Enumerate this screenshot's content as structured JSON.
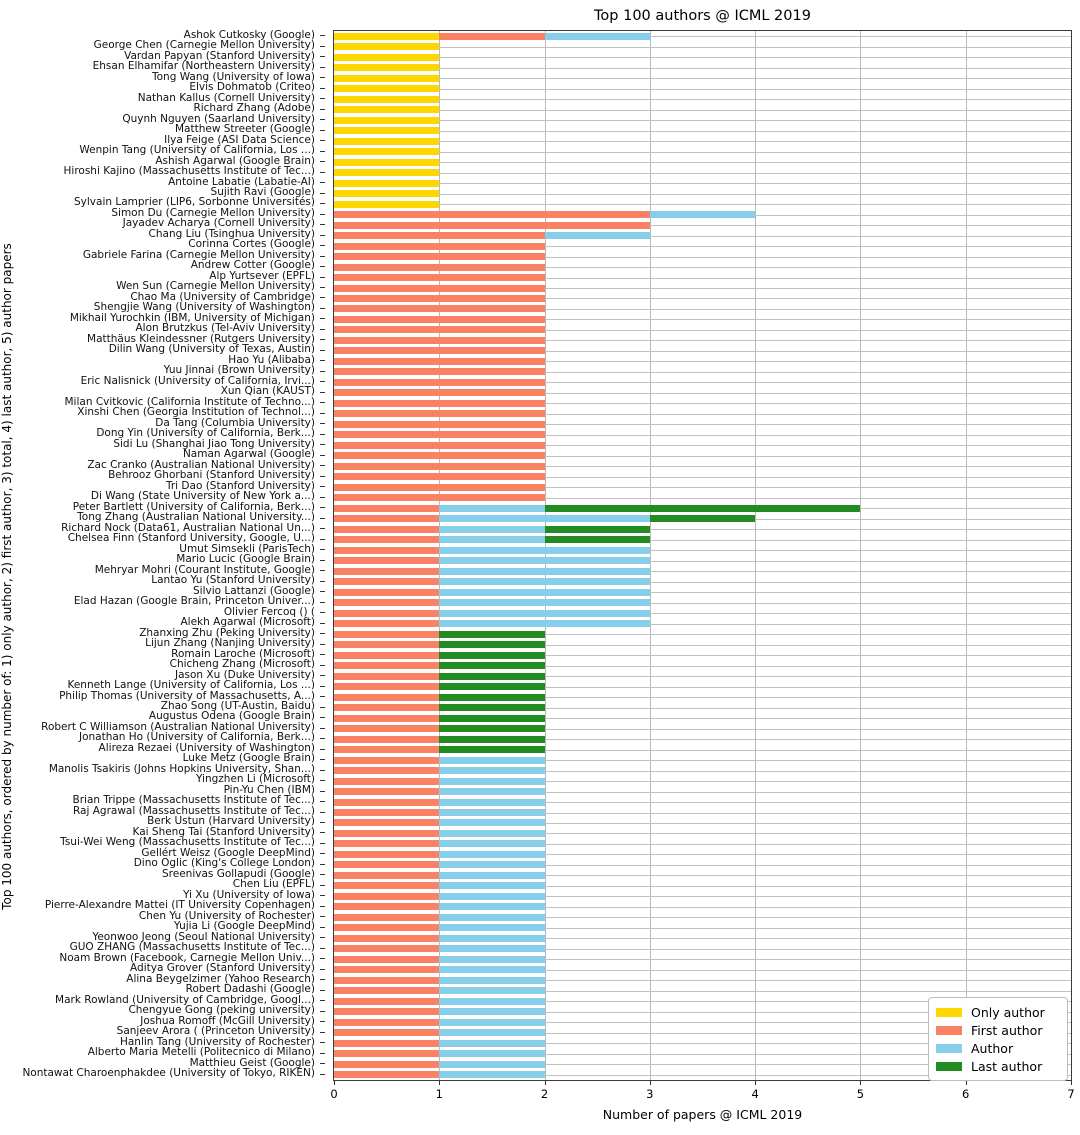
{
  "chart_data": {
    "type": "bar",
    "orientation": "horizontal",
    "stacked": true,
    "title": "Top 100 authors @ ICML 2019",
    "xlabel": "Number of papers @ ICML 2019",
    "ylabel": "Top 100 authors, ordered by number of: 1) only author, 2) first author, 3) total, 4) last author, 5) author papers",
    "xlim": [
      0,
      7
    ],
    "xticks": [
      0,
      1,
      2,
      3,
      4,
      5,
      6,
      7
    ],
    "xtick_labels": [
      "0",
      "1",
      "2",
      "3",
      "4",
      "5",
      "6",
      "7"
    ],
    "grid": true,
    "legend_position": "lower right",
    "series": [
      {
        "name": "Only author",
        "color": "#FFD700"
      },
      {
        "name": "First author",
        "color": "#FA8163"
      },
      {
        "name": "Author",
        "color": "#87CEEB"
      },
      {
        "name": "Last author",
        "color": "#228B22"
      }
    ],
    "categories": [
      "Ashok Cutkosky (Google)",
      "George Chen (Carnegie Mellon University)",
      "Vardan Papyan (Stanford University)",
      "Ehsan Elhamifar (Northeastern University)",
      "Tong Wang (University of Iowa)",
      "Elvis Dohmatob (Criteo)",
      "Nathan Kallus (Cornell University)",
      "Richard Zhang (Adobe)",
      "Quynh Nguyen (Saarland University)",
      "Matthew Streeter (Google)",
      "Ilya Feige (ASI Data Science)",
      "Wenpin Tang (University of California, Los ...)",
      "Ashish Agarwal (Google Brain)",
      "Hiroshi Kajino (Massachusetts Institute of Tec...)",
      "Antoine Labatie (Labatie-AI)",
      "Sujith Ravi (Google)",
      "Sylvain Lamprier (LIP6, Sorbonne Universités)",
      "Simon Du (Carnegie Mellon University)",
      "Jayadev Acharya (Cornell University)",
      "Chang Liu (Tsinghua University)",
      "Corinna Cortes (Google)",
      "Gabriele Farina (Carnegie Mellon University)",
      "Andrew Cotter (Google)",
      "Alp Yurtsever (EPFL)",
      "Wen Sun (Carnegie Mellon University)",
      "Chao Ma (University of Cambridge)",
      "Shengjie Wang (University of Washington)",
      "Mikhail Yurochkin (IBM, University of Michigan)",
      "Alon Brutzkus (Tel-Aviv University)",
      "Matthäus Kleindessner (Rutgers University)",
      "Dilin Wang (University of Texas, Austin)",
      "Hao Yu (Alibaba)",
      "Yuu Jinnai (Brown University)",
      "Eric Nalisnick (University of California, Irvi...)",
      "Xun Qian (KAUST)",
      "Milan Cvitkovic (California Institute of Techno...)",
      "Xinshi Chen (Georgia Institution of Technol...)",
      "Da Tang (Columbia University)",
      "Dong Yin (University of California, Berk...)",
      "Sidi Lu (Shanghai Jiao Tong University)",
      "Naman Agarwal (Google)",
      "Zac Cranko (Australian National University)",
      "Behrooz Ghorbani (Stanford University)",
      "Tri Dao (Stanford University)",
      "Di Wang (State University of New York a...)",
      "Peter Bartlett (University of California, Berk...)",
      "Tong Zhang (Australian National University...)",
      "Richard Nock (Data61, Australian National Un...)",
      "Chelsea Finn (Stanford University, Google, U...)",
      "Umut Simsekli (ParisTech)",
      "Mario Lucic (Google Brain)",
      "Mehryar Mohri (Courant Institute, Google)",
      "Lantao Yu (Stanford University)",
      "Silvio Lattanzi (Google)",
      "Elad Hazan (Google Brain, Princeton Univer...)",
      "Olivier Fercoq () (",
      "Alekh Agarwal (Microsoft)",
      "Zhanxing Zhu (Peking University)",
      "Lijun Zhang (Nanjing University)",
      "Romain Laroche (Microsoft)",
      "Chicheng Zhang (Microsoft)",
      "Jason Xu (Duke University)",
      "Kenneth Lange (University of California, Los ...)",
      "Philip Thomas (University of Massachusetts, A...)",
      "Zhao Song (UT-Austin, Baidu)",
      "Augustus Odena (Google Brain)",
      "Robert C Williamson (Australian National University)",
      "Jonathan Ho (University of California, Berk...)",
      "Alireza Rezaei (University of Washington)",
      "Luke Metz (Google Brain)",
      "Manolis Tsakiris (Johns Hopkins University, Shan...)",
      "Yingzhen Li (Microsoft)",
      "Pin-Yu Chen (IBM)",
      "Brian Trippe (Massachusetts Institute of Tec...)",
      "Raj Agrawal (Massachusetts Institute of Tec...)",
      "Berk Ustun (Harvard University)",
      "Kai Sheng Tai (Stanford University)",
      "Tsui-Wei Weng (Massachusetts Institute of Tec...)",
      "Gellért Weisz (Google DeepMind)",
      "Dino Oglic (King's College London)",
      "Sreenivas Gollapudi (Google)",
      "Chen Liu (EPFL)",
      "Yi Xu (University of Iowa)",
      "Pierre-Alexandre Mattei (IT University Copenhagen)",
      "Chen Yu (University of Rochester)",
      "Yujia Li (Google DeepMind)",
      "Yeonwoo Jeong (Seoul National University)",
      "GUO ZHANG (Massachusetts Institute of Tec...)",
      "Noam Brown (Facebook, Carnegie Mellon Univ...)",
      "Aditya Grover (Stanford University)",
      "Alina Beygelzimer (Yahoo Research)",
      "Robert Dadashi (Google)",
      "Mark Rowland (University of Cambridge, Googl...)",
      "Chengyue Gong (peking university)",
      "Joshua Romoff (McGill University)",
      "Sanjeev Arora ( (Princeton University)",
      "Hanlin Tang (University of Rochester)",
      "Alberto Maria Metelli (Politecnico di Milano)",
      "Matthieu Geist (Google)",
      "Nontawat Charoenphakdee (University of Tokyo, RIKEN)"
    ],
    "stacks": [
      [
        1,
        1,
        1,
        0
      ],
      [
        1,
        0,
        0,
        0
      ],
      [
        1,
        0,
        0,
        0
      ],
      [
        1,
        0,
        0,
        0
      ],
      [
        1,
        0,
        0,
        0
      ],
      [
        1,
        0,
        0,
        0
      ],
      [
        1,
        0,
        0,
        0
      ],
      [
        1,
        0,
        0,
        0
      ],
      [
        1,
        0,
        0,
        0
      ],
      [
        1,
        0,
        0,
        0
      ],
      [
        1,
        0,
        0,
        0
      ],
      [
        1,
        0,
        0,
        0
      ],
      [
        1,
        0,
        0,
        0
      ],
      [
        1,
        0,
        0,
        0
      ],
      [
        1,
        0,
        0,
        0
      ],
      [
        1,
        0,
        0,
        0
      ],
      [
        1,
        0,
        0,
        0
      ],
      [
        0,
        3,
        1,
        0
      ],
      [
        0,
        3,
        0,
        0
      ],
      [
        0,
        2,
        1,
        0
      ],
      [
        0,
        2,
        0,
        0
      ],
      [
        0,
        2,
        0,
        0
      ],
      [
        0,
        2,
        0,
        0
      ],
      [
        0,
        2,
        0,
        0
      ],
      [
        0,
        2,
        0,
        0
      ],
      [
        0,
        2,
        0,
        0
      ],
      [
        0,
        2,
        0,
        0
      ],
      [
        0,
        2,
        0,
        0
      ],
      [
        0,
        2,
        0,
        0
      ],
      [
        0,
        2,
        0,
        0
      ],
      [
        0,
        2,
        0,
        0
      ],
      [
        0,
        2,
        0,
        0
      ],
      [
        0,
        2,
        0,
        0
      ],
      [
        0,
        2,
        0,
        0
      ],
      [
        0,
        2,
        0,
        0
      ],
      [
        0,
        2,
        0,
        0
      ],
      [
        0,
        2,
        0,
        0
      ],
      [
        0,
        2,
        0,
        0
      ],
      [
        0,
        2,
        0,
        0
      ],
      [
        0,
        2,
        0,
        0
      ],
      [
        0,
        2,
        0,
        0
      ],
      [
        0,
        2,
        0,
        0
      ],
      [
        0,
        2,
        0,
        0
      ],
      [
        0,
        2,
        0,
        0
      ],
      [
        0,
        2,
        0,
        0
      ],
      [
        0,
        1,
        1,
        3
      ],
      [
        0,
        1,
        2,
        1
      ],
      [
        0,
        1,
        1,
        1
      ],
      [
        0,
        1,
        1,
        1
      ],
      [
        0,
        1,
        2,
        0
      ],
      [
        0,
        1,
        2,
        0
      ],
      [
        0,
        1,
        2,
        0
      ],
      [
        0,
        1,
        2,
        0
      ],
      [
        0,
        1,
        2,
        0
      ],
      [
        0,
        1,
        2,
        0
      ],
      [
        0,
        1,
        2,
        0
      ],
      [
        0,
        1,
        2,
        0
      ],
      [
        0,
        1,
        0,
        1
      ],
      [
        0,
        1,
        0,
        1
      ],
      [
        0,
        1,
        0,
        1
      ],
      [
        0,
        1,
        0,
        1
      ],
      [
        0,
        1,
        0,
        1
      ],
      [
        0,
        1,
        0,
        1
      ],
      [
        0,
        1,
        0,
        1
      ],
      [
        0,
        1,
        0,
        1
      ],
      [
        0,
        1,
        0,
        1
      ],
      [
        0,
        1,
        0,
        1
      ],
      [
        0,
        1,
        0,
        1
      ],
      [
        0,
        1,
        0,
        1
      ],
      [
        0,
        1,
        1,
        0
      ],
      [
        0,
        1,
        1,
        0
      ],
      [
        0,
        1,
        1,
        0
      ],
      [
        0,
        1,
        1,
        0
      ],
      [
        0,
        1,
        1,
        0
      ],
      [
        0,
        1,
        1,
        0
      ],
      [
        0,
        1,
        1,
        0
      ],
      [
        0,
        1,
        1,
        0
      ],
      [
        0,
        1,
        1,
        0
      ],
      [
        0,
        1,
        1,
        0
      ],
      [
        0,
        1,
        1,
        0
      ],
      [
        0,
        1,
        1,
        0
      ],
      [
        0,
        1,
        1,
        0
      ],
      [
        0,
        1,
        1,
        0
      ],
      [
        0,
        1,
        1,
        0
      ],
      [
        0,
        1,
        1,
        0
      ],
      [
        0,
        1,
        1,
        0
      ],
      [
        0,
        1,
        1,
        0
      ],
      [
        0,
        1,
        1,
        0
      ],
      [
        0,
        1,
        1,
        0
      ],
      [
        0,
        1,
        1,
        0
      ],
      [
        0,
        1,
        1,
        0
      ],
      [
        0,
        1,
        1,
        0
      ],
      [
        0,
        1,
        1,
        0
      ],
      [
        0,
        1,
        1,
        0
      ],
      [
        0,
        1,
        1,
        0
      ],
      [
        0,
        1,
        1,
        0
      ],
      [
        0,
        1,
        1,
        0
      ],
      [
        0,
        1,
        1,
        0
      ],
      [
        0,
        1,
        1,
        0
      ],
      [
        0,
        1,
        1,
        0
      ]
    ]
  }
}
